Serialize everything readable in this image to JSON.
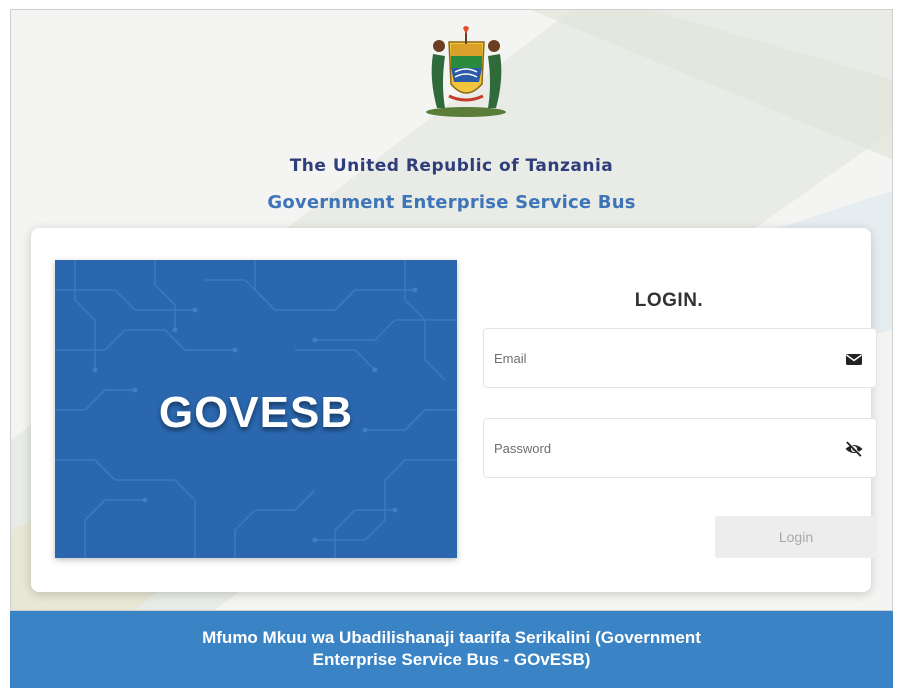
{
  "header": {
    "emblem_icon": "tanzania-coat-of-arms-icon",
    "country": "The United Republic of Tanzania",
    "system": "Government Enterprise Service Bus"
  },
  "banner": {
    "text": "GOVESB",
    "color": "#2a67ae"
  },
  "login": {
    "title": "LOGIN.",
    "email_placeholder": "Email",
    "email_icon": "envelope-icon",
    "password_placeholder": "Password",
    "password_icon": "eye-off-icon",
    "button_label": "Login"
  },
  "footer": {
    "line1": "Mfumo Mkuu wa Ubadilishanaji taarifa Serikalini (Government",
    "line2": "Enterprise Service Bus - GOvESB)",
    "color": "#3a84c6"
  }
}
